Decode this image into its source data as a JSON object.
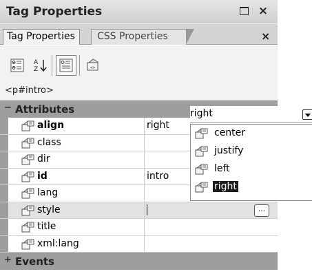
{
  "panel": {
    "title": "Tag Properties",
    "tabs": [
      {
        "label": "Tag Properties",
        "active": true
      },
      {
        "label": "CSS Properties",
        "active": false
      }
    ],
    "close_glyph": "×",
    "tab_close_glyph": "×"
  },
  "toolbar": {
    "buttons": [
      {
        "icon": "category-view-icon"
      },
      {
        "icon": "sort-az-icon"
      },
      {
        "icon": "show-set-properties-icon",
        "pressed": true
      },
      {
        "icon": "tag-icon"
      }
    ],
    "tag_path": "<p#intro>"
  },
  "grid": {
    "attributes_category": {
      "toggle": "−",
      "label": "Attributes"
    },
    "events_category": {
      "toggle": "+",
      "label": "Events"
    },
    "properties": [
      {
        "name": "align",
        "value": "right",
        "bold": true
      },
      {
        "name": "class",
        "value": ""
      },
      {
        "name": "dir",
        "value": ""
      },
      {
        "name": "id",
        "value": "intro",
        "bold": true
      },
      {
        "name": "lang",
        "value": ""
      },
      {
        "name": "style",
        "value": "",
        "selected": true
      },
      {
        "name": "title",
        "value": ""
      },
      {
        "name": "xml:lang",
        "value": ""
      }
    ],
    "ellipsis_label": "..."
  },
  "dropdown": {
    "value": "right",
    "options": [
      "center",
      "justify",
      "left",
      "right"
    ],
    "highlighted": "right"
  }
}
